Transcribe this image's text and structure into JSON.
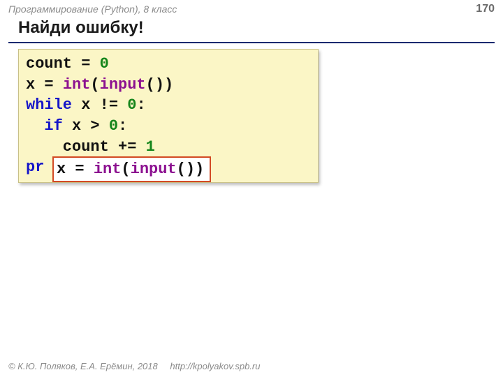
{
  "header": {
    "course": "Программирование (Python), 8 класс",
    "page": "170"
  },
  "title": "Найди ошибку!",
  "code": {
    "l1a": "count",
    "l1b": " = ",
    "l1c": "0",
    "l2a": "x = ",
    "l2b": "int",
    "l2c": "(",
    "l2d": "input",
    "l2e": "())",
    "l3a": "while",
    "l3b": " x != ",
    "l3c": "0",
    "l3d": ":",
    "l4a": "  if",
    "l4b": " x > ",
    "l4c": "0",
    "l4d": ":",
    "l5": "    count += ",
    "l5b": "1",
    "l6a": "pr"
  },
  "overlay": {
    "a": "x = ",
    "b": "int",
    "c": "(",
    "d": "input",
    "e": "())"
  },
  "footer": {
    "copyright": "© К.Ю. Поляков, Е.А. Ерёмин, 2018",
    "url": "http://kpolyakov.spb.ru"
  }
}
